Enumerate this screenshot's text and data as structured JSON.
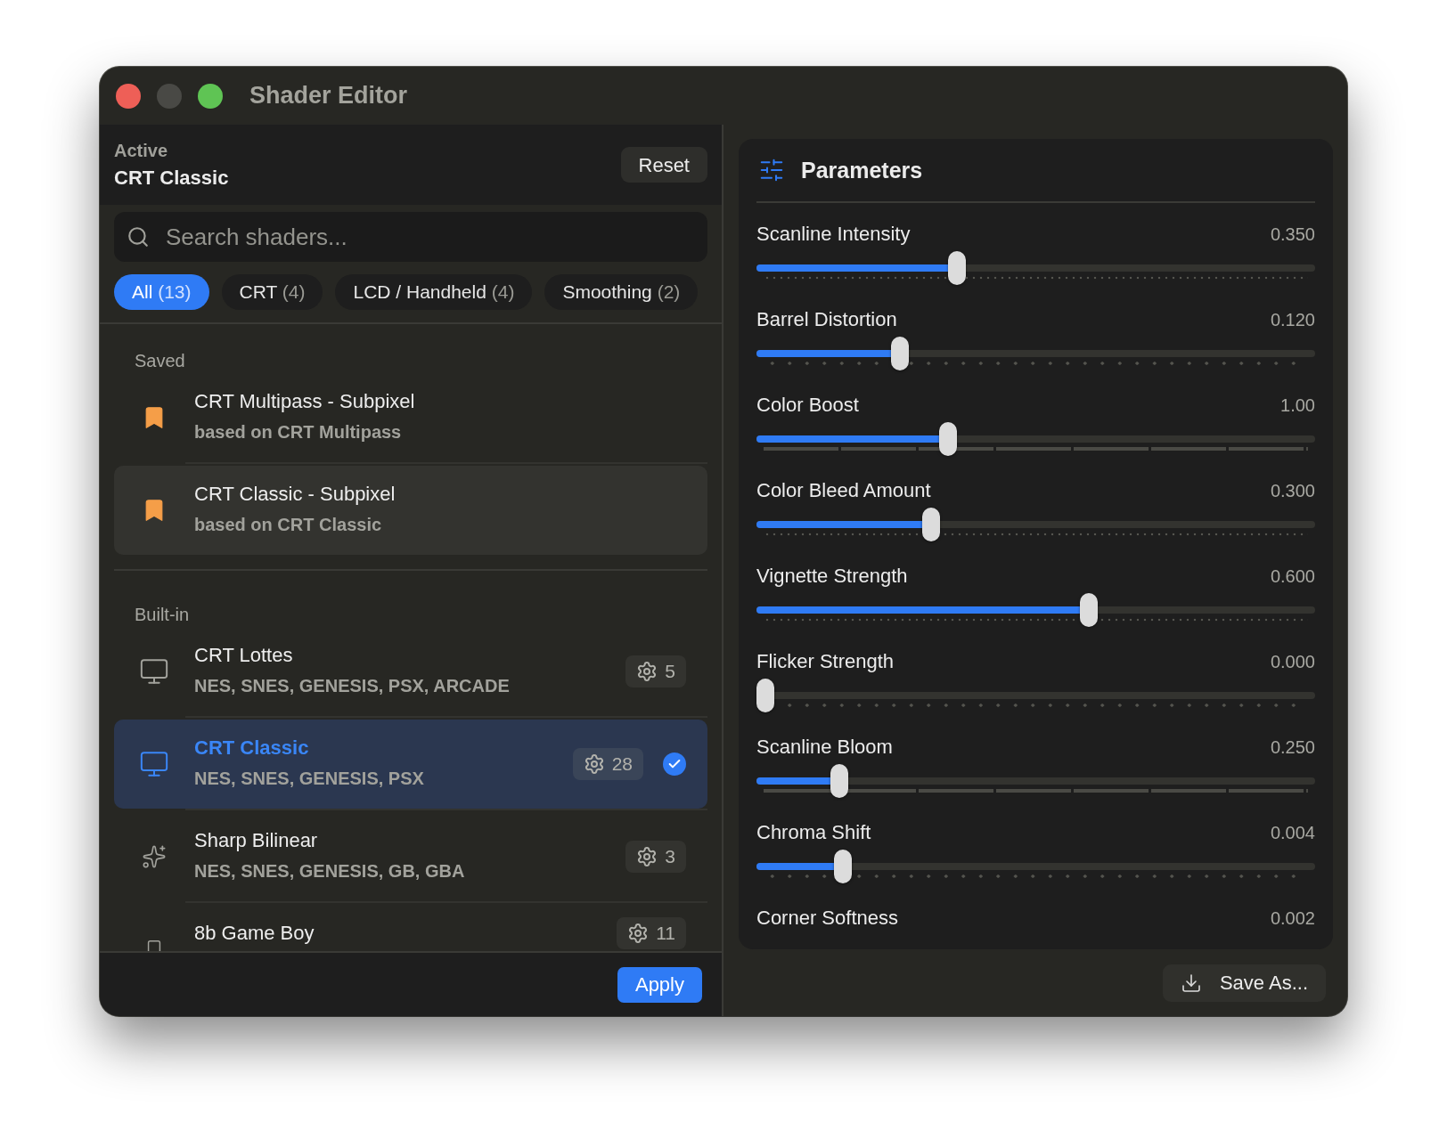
{
  "window": {
    "title": "Shader Editor"
  },
  "active": {
    "label": "Active",
    "name": "CRT Classic"
  },
  "reset_button": "Reset",
  "search": {
    "placeholder": "Search shaders..."
  },
  "filters": [
    {
      "label": "All",
      "count": "(13)",
      "selected": true
    },
    {
      "label": "CRT",
      "count": "(4)",
      "selected": false
    },
    {
      "label": "LCD / Handheld",
      "count": "(4)",
      "selected": false
    },
    {
      "label": "Smoothing",
      "count": "(2)",
      "selected": false
    }
  ],
  "groups": [
    {
      "title": "Saved",
      "items": [
        {
          "kind": "bookmark",
          "name": "CRT Multipass - Subpixel",
          "subtitle": "based on CRT Multipass",
          "selected": false,
          "hovered": false
        },
        {
          "kind": "bookmark",
          "name": "CRT Classic - Subpixel",
          "subtitle": "based on CRT Classic",
          "selected": false,
          "hovered": true
        }
      ]
    },
    {
      "title": "Built-in",
      "items": [
        {
          "kind": "monitor",
          "name": "CRT Lottes",
          "subtitle": "NES, SNES, GENESIS, PSX, ARCADE",
          "params": "5",
          "selected": false,
          "hovered": false
        },
        {
          "kind": "monitor",
          "name": "CRT Classic",
          "subtitle": "NES, SNES, GENESIS, PSX",
          "params": "28",
          "selected": true,
          "hovered": false
        },
        {
          "kind": "sparkle",
          "name": "Sharp Bilinear",
          "subtitle": "NES, SNES, GENESIS, GB, GBA",
          "params": "3",
          "selected": false,
          "hovered": false
        },
        {
          "kind": "handheld",
          "name": "8b Game Boy",
          "params": "11",
          "selected": false,
          "hovered": false
        }
      ]
    }
  ],
  "apply_button": "Apply",
  "parameters": {
    "title": "Parameters",
    "items": [
      {
        "label": "Scanline Intensity",
        "value": "0.350",
        "level": 0.354,
        "kind": "fine"
      },
      {
        "label": "Barrel Distortion",
        "value": "0.120",
        "level": 0.248,
        "kind": "sparse"
      },
      {
        "label": "Color Boost",
        "value": "1.00",
        "level": 0.338,
        "kind": "segmented"
      },
      {
        "label": "Color Bleed Amount",
        "value": "0.300",
        "level": 0.306,
        "kind": "fine"
      },
      {
        "label": "Vignette Strength",
        "value": "0.600",
        "level": 0.598,
        "kind": "fine"
      },
      {
        "label": "Flicker Strength",
        "value": "0.000",
        "level": 0,
        "kind": "sparse"
      },
      {
        "label": "Scanline Bloom",
        "value": "0.250",
        "level": 0.136,
        "kind": "segmented"
      },
      {
        "label": "Chroma Shift",
        "value": "0.004",
        "level": 0.144,
        "kind": "sparse"
      },
      {
        "label": "Corner Softness",
        "value": "0.002"
      }
    ]
  },
  "save_button": "Save As..."
}
